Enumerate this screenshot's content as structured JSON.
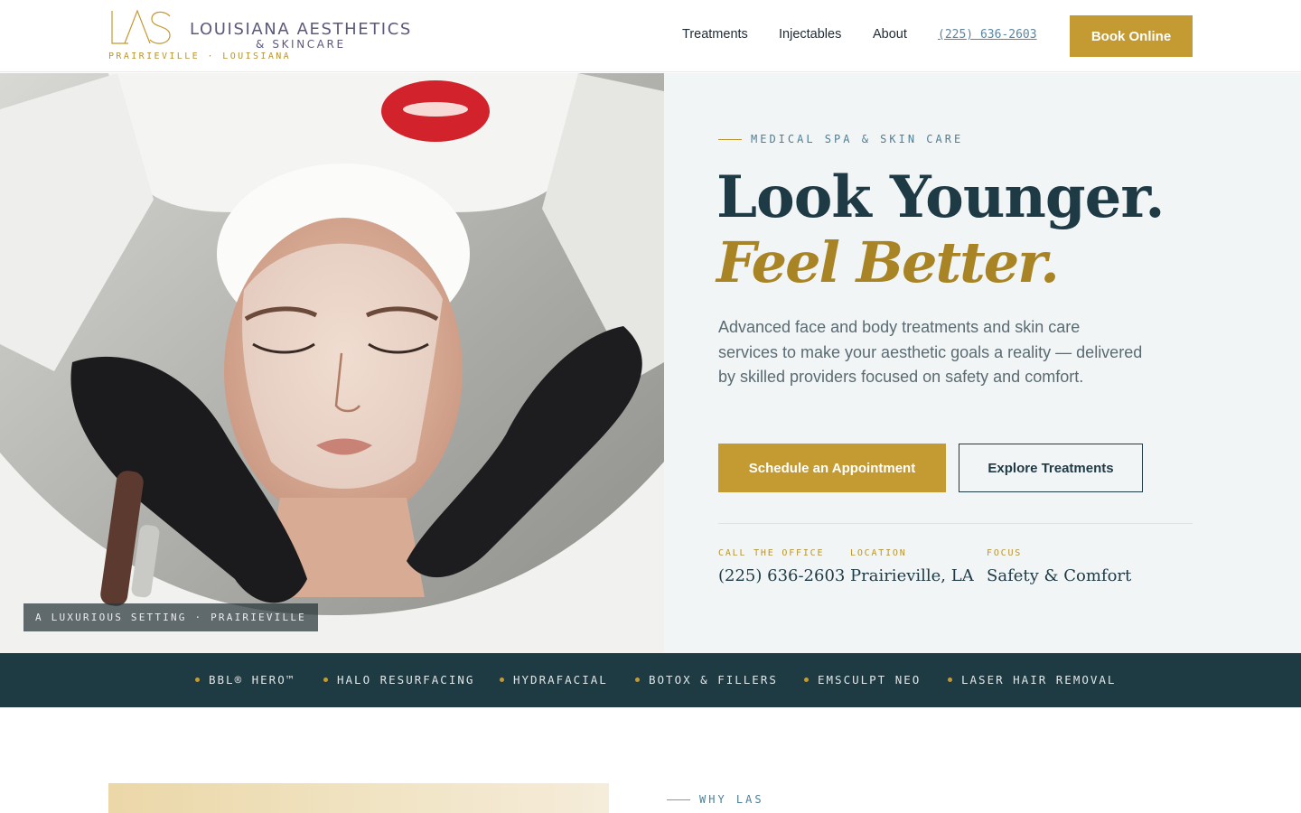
{
  "header": {
    "logo_mark": "LAS",
    "brand_name": "LOUISIANA AESTHETICS",
    "brand_sub": "& SKINCARE",
    "brand_tagline": "PRAIRIEVILLE · LOUISIANA",
    "nav": [
      "Treatments",
      "Injectables",
      "About"
    ],
    "phone": "(225) 636-2603",
    "book_label": "Book Online"
  },
  "hero": {
    "image_caption": "A LUXURIOUS SETTING · PRAIRIEVILLE",
    "eyebrow": "MEDICAL SPA & SKIN CARE",
    "headline_1": "Look Younger.",
    "headline_2": "Feel Better.",
    "lede": "Advanced face and body treatments and skin care services to make your aesthetic goals a reality — delivered by skilled providers focused on safety and comfort.",
    "primary_cta": "Schedule an Appointment",
    "secondary_cta": "Explore Treatments",
    "stats": [
      {
        "label": "CALL THE OFFICE",
        "value": "(225) 636-2603"
      },
      {
        "label": "LOCATION",
        "value": "Prairieville, LA"
      },
      {
        "label": "FOCUS",
        "value": "Safety & Comfort"
      }
    ]
  },
  "ticker": [
    "BBL® HERO™",
    "HALO RESURFACING",
    "HYDRAFACIAL",
    "BOTOX & FILLERS",
    "EMSCULPT NEO",
    "LASER HAIR REMOVAL"
  ],
  "section": {
    "eyebrow": "WHY LAS"
  },
  "colors": {
    "gold": "#c49a33",
    "navy": "#1e3a42",
    "hero_panel": "#f2f5f6"
  }
}
